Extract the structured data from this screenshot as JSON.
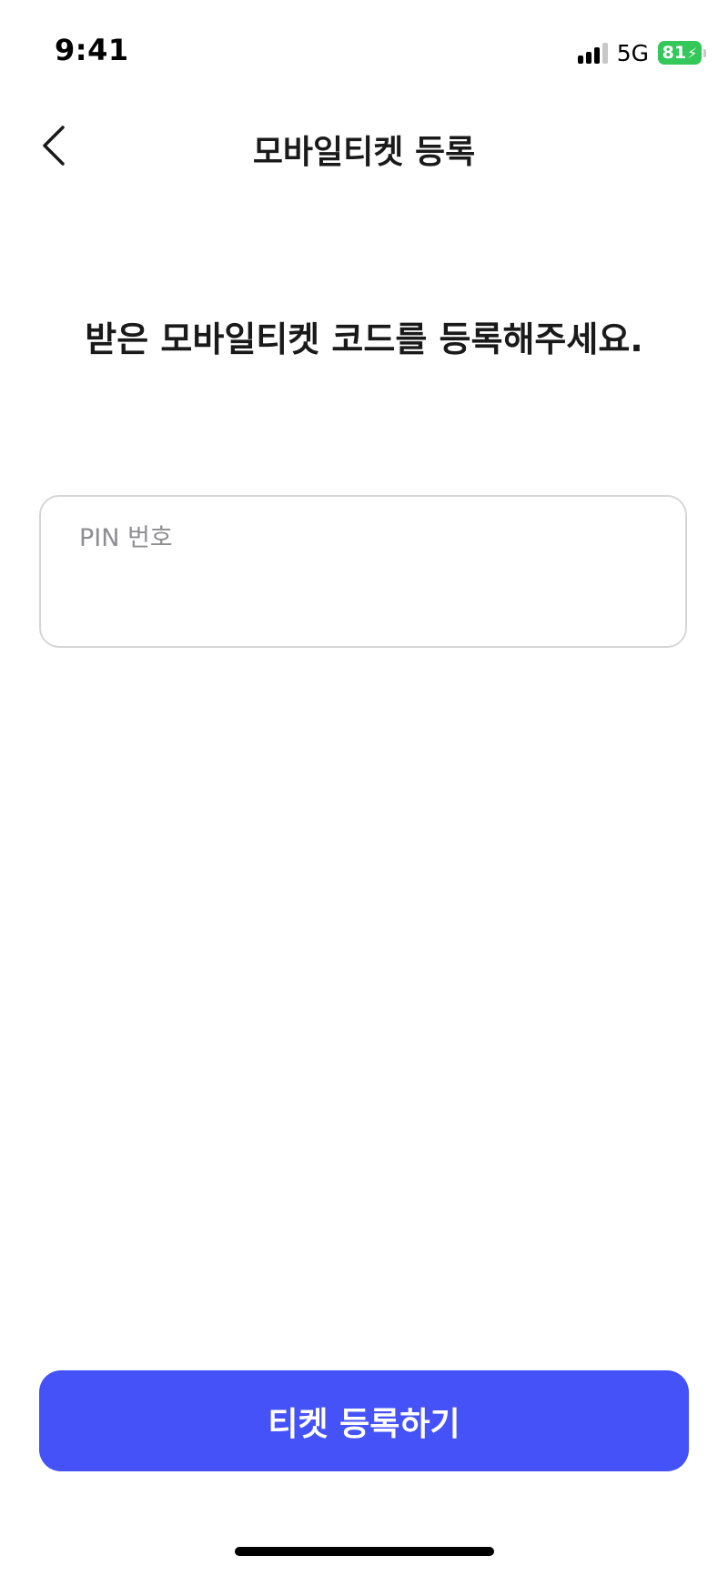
{
  "status_bar": {
    "time": "9:41",
    "network": "5G",
    "battery_level": "81",
    "battery_color": "#34c759",
    "signal_icon": "cellular-signal-icon",
    "battery_icon": "battery-charging-icon"
  },
  "header": {
    "back_icon": "chevron-left-icon",
    "title": "모바일티켓 등록"
  },
  "main": {
    "heading": "받은 모바일티켓 코드를 등록해주세요.",
    "pin_input": {
      "placeholder": "PIN 번호",
      "value": ""
    }
  },
  "footer": {
    "submit_label": "티켓 등록하기",
    "accent_color": "#4552f8"
  }
}
